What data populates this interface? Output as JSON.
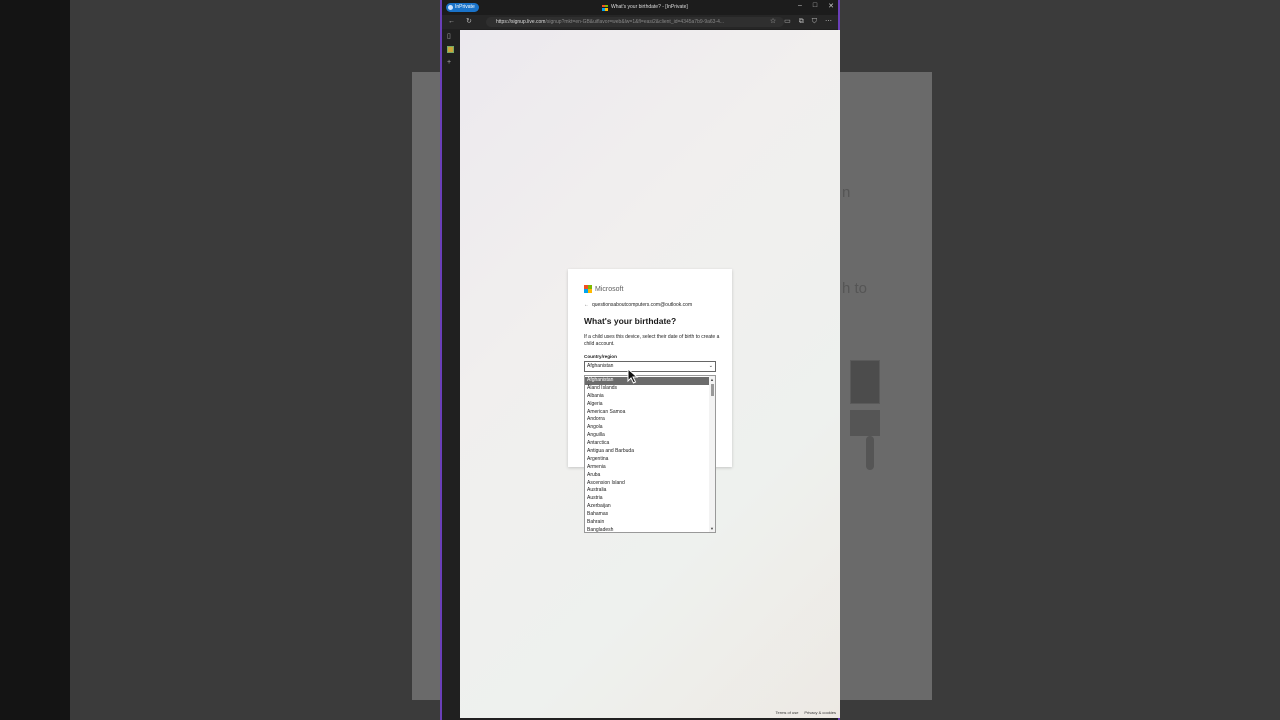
{
  "browser": {
    "mode_badge": "InPrivate",
    "window_title": "What's your birthdate? - [InPrivate]",
    "url_host": "https://signup.live.com",
    "url_rest": "/signup?mkt=en-GB&uiflavor=web&lw=1&fl=easi2&client_id=4345a7b9-9a63-4...",
    "win_min": "–",
    "win_max": "□",
    "win_close": "✕"
  },
  "page": {
    "footer_terms": "Terms of use",
    "footer_privacy": "Privacy & cookies"
  },
  "card": {
    "brand": "Microsoft",
    "back_arrow": "←",
    "identity_email": "questionsaboutcomputers.com@outlook.com",
    "heading": "What's your birthdate?",
    "description": "If a child uses this device, select their date of birth to create a child account.",
    "country_label": "Country/region",
    "country_value": "Afghanistan"
  },
  "dropdown": {
    "options": [
      "Afghanistan",
      "Åland Islands",
      "Albania",
      "Algeria",
      "American Samoa",
      "Andorra",
      "Angola",
      "Anguilla",
      "Antarctica",
      "Antigua and Barbuda",
      "Argentina",
      "Armenia",
      "Aruba",
      "Ascension Island",
      "Australia",
      "Austria",
      "Azerbaijan",
      "Bahamas",
      "Bahrain",
      "Bangladesh"
    ],
    "selected_index": 0
  },
  "icons": {
    "back": "←",
    "refresh": "↻",
    "lock": "🔒",
    "star": "☆",
    "split": "▭",
    "collections": "⧉",
    "extensions": "⛉",
    "more": "⋯",
    "tabs": "▯",
    "add": "+"
  }
}
